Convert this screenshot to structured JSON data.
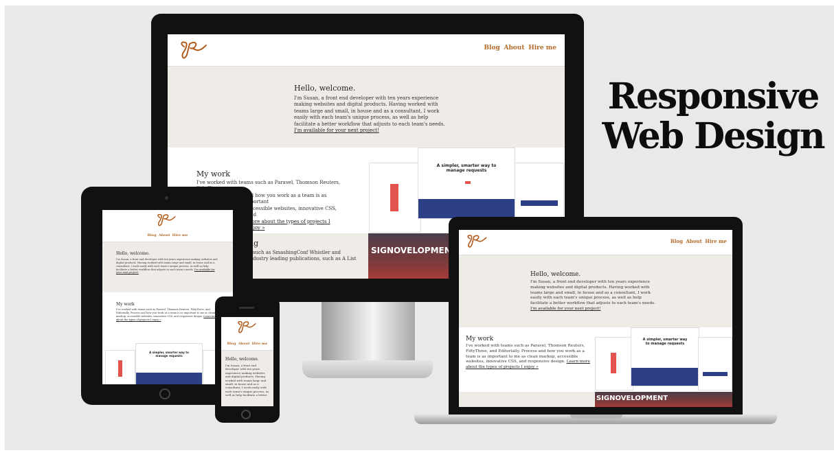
{
  "headline": {
    "line1": "Responsive",
    "line2": "Web Design"
  },
  "site": {
    "logo_icon": "signature-logo-SR",
    "nav": [
      "Blog",
      "About",
      "Hire me"
    ],
    "hero": {
      "title": "Hello, welcome.",
      "intro": "I'm Susan, a front end developer with ten years experience making websites and digital products. Having worked with teams large and small, in house and as a consultant, I work easily with each team's unique process, as well as help facilitate a better workflow that adjusts to each team's needs.",
      "cta": "I'm available for your next project!"
    },
    "work": {
      "title": "My work",
      "text": "I've worked with teams such as Paravel, Thomson Reuters, FiftyThree, and Editorially. Process and how you work as a team is as important to me as clean markup, accessible websites, innovative CSS, and responsive design.",
      "link": "Learn more about the types of projects I enjoy »",
      "monitor_text_a": "I've worked with teams such as Paravel, Thomson Reuters, FiftyThree,",
      "monitor_text_b": "and how you work as a team is as important",
      "monitor_text_c": "accessible websites, innovative CSS, and",
      "monitor_link": "more about the types of projects I enjoy »"
    },
    "speaking": {
      "title_fragment": "ng",
      "line1": "such as SmashingConf Whistler and",
      "line2": "dustry leading publications, such as A List"
    },
    "project_thumb": {
      "title": "A simpler, smarter way to manage requests"
    },
    "banner_text": "SIGNOVELOPMENT",
    "phone_intro": "I'm Susan, a front end developer with ten years experience making websites and digital products. Having worked with teams large and small, in house and as a consultant, I work easily with each team's unique process, as well as help facilitate a better"
  }
}
